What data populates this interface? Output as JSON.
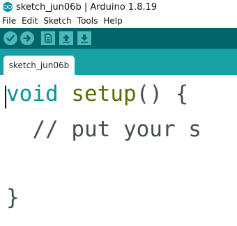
{
  "window": {
    "title": "sketch_jun06b | Arduino 1.8.19",
    "logo_icon": "arduino-logo-icon"
  },
  "menu": [
    "File",
    "Edit",
    "Sketch",
    "Tools",
    "Help"
  ],
  "toolbar": {
    "buttons": [
      {
        "name": "verify",
        "icon": "checkmark-icon"
      },
      {
        "name": "upload",
        "icon": "arrow-right-icon"
      },
      {
        "name": "new",
        "icon": "new-file-icon"
      },
      {
        "name": "open",
        "icon": "arrow-up-icon"
      },
      {
        "name": "save",
        "icon": "arrow-down-icon"
      }
    ]
  },
  "tabs": [
    {
      "label": "sketch_jun06b",
      "active": true
    }
  ],
  "editor": {
    "lines": [
      {
        "keyword": "void",
        "function": "setup",
        "rest": "() {"
      },
      {
        "indent": "  ",
        "comment": "// put your s"
      },
      {
        "text": "}"
      }
    ]
  },
  "colors": {
    "toolbar_bg": "#006468",
    "tabbar_bg": "#17a1a5",
    "button_fill": "#4db7bb",
    "keyword": "#00979c",
    "function": "#5e6d03",
    "text": "#434f54"
  }
}
